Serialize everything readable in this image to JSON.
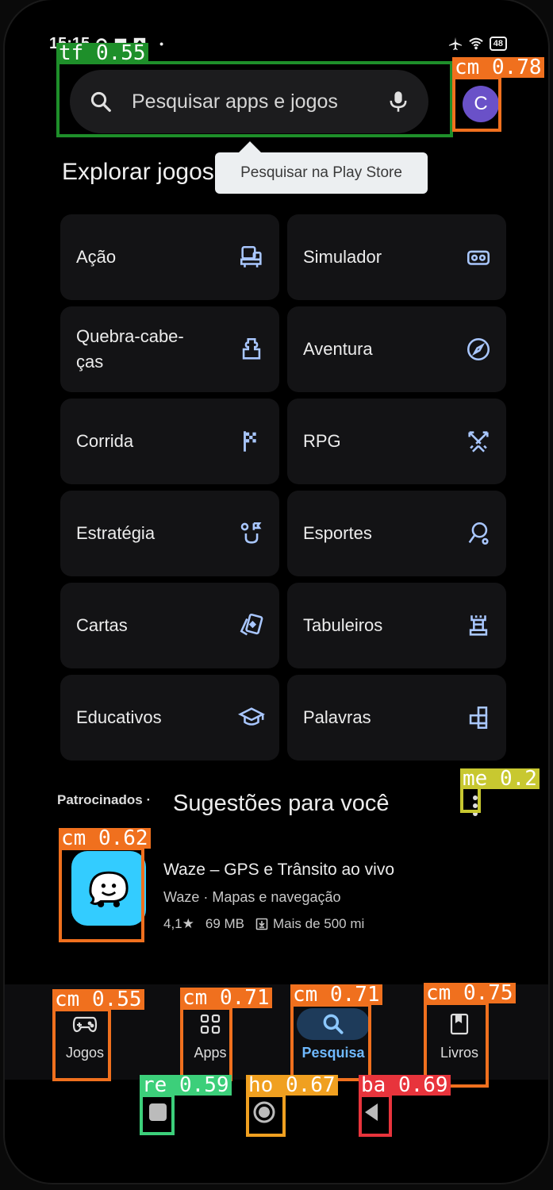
{
  "status_bar": {
    "time": "15:15",
    "battery": "48"
  },
  "search": {
    "placeholder": "Pesquisar apps e jogos",
    "avatar_letter": "C"
  },
  "tooltip": "Pesquisar na Play Store",
  "section_title": "Explorar jogos",
  "categories": [
    {
      "label": "Ação",
      "icon": "arcade-icon"
    },
    {
      "label": "Simulador",
      "icon": "vr-headset-icon"
    },
    {
      "label": "Quebra-cabe-ças",
      "icon": "puzzle-icon"
    },
    {
      "label": "Aventura",
      "icon": "compass-icon"
    },
    {
      "label": "Corrida",
      "icon": "checkered-flag-icon"
    },
    {
      "label": "RPG",
      "icon": "crossed-swords-icon"
    },
    {
      "label": "Estratégia",
      "icon": "strategy-icon"
    },
    {
      "label": "Esportes",
      "icon": "racket-icon"
    },
    {
      "label": "Cartas",
      "icon": "cards-icon"
    },
    {
      "label": "Tabuleiros",
      "icon": "chess-rook-icon"
    },
    {
      "label": "Educativos",
      "icon": "graduation-cap-icon"
    },
    {
      "label": "Palavras",
      "icon": "word-tiles-icon"
    }
  ],
  "suggestions": {
    "sponsored": "Patrocinados",
    "separator": "·",
    "title": "Sugestões para você"
  },
  "app": {
    "name": "Waze – GPS e Trânsito ao vivo",
    "developer": "Waze",
    "category": "Mapas e navegação",
    "rating": "4,1★",
    "size": "69 MB",
    "downloads": "Mais de 500 mi"
  },
  "bottom_nav": [
    {
      "label": "Jogos",
      "active": false
    },
    {
      "label": "Apps",
      "active": false
    },
    {
      "label": "Pesquisa",
      "active": true
    },
    {
      "label": "Livros",
      "active": false
    }
  ],
  "annotations": [
    {
      "tag": "tf 0.55",
      "color": "#1e8f2a"
    },
    {
      "tag": "cm 0.78",
      "color": "#f0701e"
    },
    {
      "tag": "me 0.2",
      "color": "#c8c830"
    },
    {
      "tag": "cm 0.62",
      "color": "#f0701e"
    },
    {
      "tag": "cm 0.55",
      "color": "#f0701e"
    },
    {
      "tag": "cm 0.71",
      "color": "#f0701e"
    },
    {
      "tag": "cm 0.71",
      "color": "#f0701e"
    },
    {
      "tag": "cm 0.75",
      "color": "#f0701e"
    },
    {
      "tag": "re 0.59",
      "color": "#3ccf7a"
    },
    {
      "tag": "ho 0.67",
      "color": "#f0a020"
    },
    {
      "tag": "ba 0.69",
      "color": "#e8343c"
    }
  ]
}
